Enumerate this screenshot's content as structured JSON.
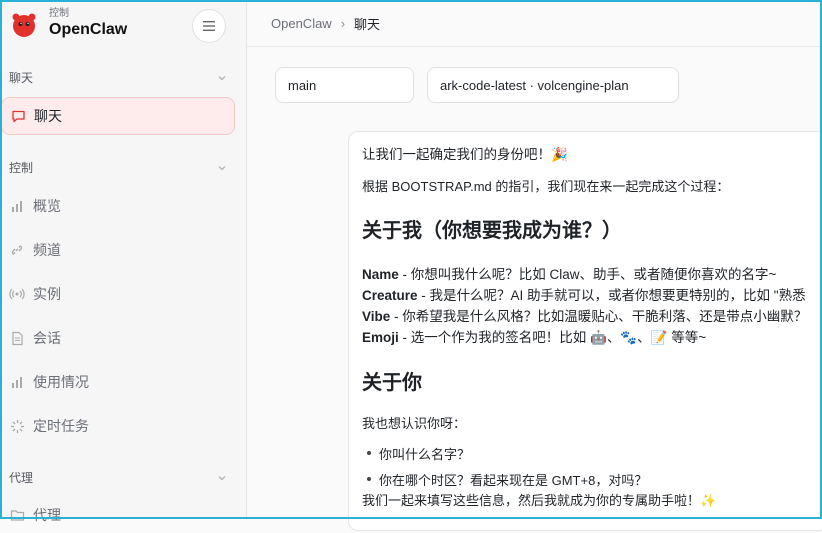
{
  "app": {
    "sub_label": "控制",
    "name": "OpenClaw"
  },
  "sidebar": {
    "section_chat": "聊天",
    "active_item": "聊天",
    "section_control": "控制",
    "control_items": [
      "概览",
      "频道",
      "实例",
      "会话",
      "使用情况",
      "定时任务"
    ],
    "section_agent": "代理",
    "agent_items": [
      "代理"
    ]
  },
  "breadcrumb": {
    "root": "OpenClaw",
    "sep": "›",
    "current": "聊天"
  },
  "selectors": {
    "session": "main",
    "model": "ark-code-latest · volcengine-plan"
  },
  "message": {
    "line1": "让我们一起确定我们的身份吧！🎉",
    "line2": "根据 BOOTSTRAP.md 的指引，我们现在来一起完成这个过程：",
    "heading1": "关于我（你想要我成为谁？）",
    "items": [
      {
        "key": "Name",
        "text": " - 你想叫我什么呢？比如 Claw、助手、或者随便你喜欢的名字~"
      },
      {
        "key": "Creature",
        "text": " - 我是什么呢？AI 助手就可以，或者你想要更特别的，比如 \"熟悉"
      },
      {
        "key": "Vibe",
        "text": " - 你希望我是什么风格？比如温暖贴心、干脆利落、还是带点小幽默？"
      },
      {
        "key": "Emoji",
        "text": " - 选一个作为我的签名吧！比如 🤖、🐾、📝 等等~"
      }
    ],
    "heading2": "关于你",
    "intro2": "我也想认识你呀：",
    "bullets": [
      "你叫什么名字？",
      "你在哪个时区？看起来现在是 GMT+8，对吗？"
    ],
    "closing": "我们一起来填写这些信息，然后我就成为你的专属助手啦！✨"
  }
}
